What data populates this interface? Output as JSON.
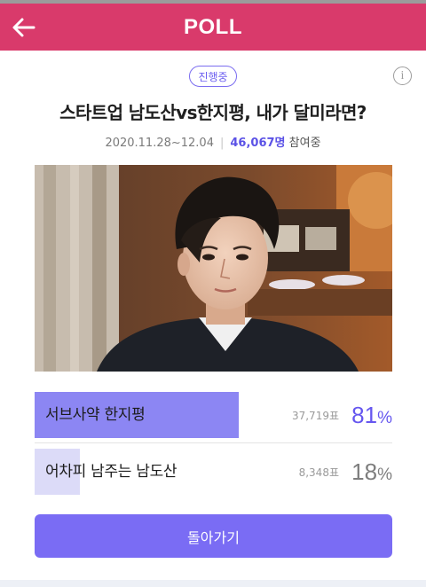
{
  "header": {
    "title": "POLL",
    "back_icon": "arrow-left-icon"
  },
  "status": {
    "badge": "진행중",
    "info_icon": "info-icon",
    "info_glyph": "i"
  },
  "poll": {
    "title": "스타트업 남도산vs한지평, 내가 달미라면?",
    "period": "2020.11.28~12.04",
    "participants": "46,067명",
    "participants_suffix": "참여중"
  },
  "options": [
    {
      "label": "서브사약 한지평",
      "votes": "37,719표",
      "percent": "81",
      "percent_value": 81
    },
    {
      "label": "어차피 남주는 남도산",
      "votes": "8,348표",
      "percent": "18",
      "percent_value": 18
    }
  ],
  "percent_sign": "%",
  "actions": {
    "back_button": "돌아가기"
  },
  "colors": {
    "header": "#d93a6b",
    "accent": "#7a6cf4",
    "winner_fill": "#8c86f3",
    "loser_fill": "#dcdbf8"
  }
}
